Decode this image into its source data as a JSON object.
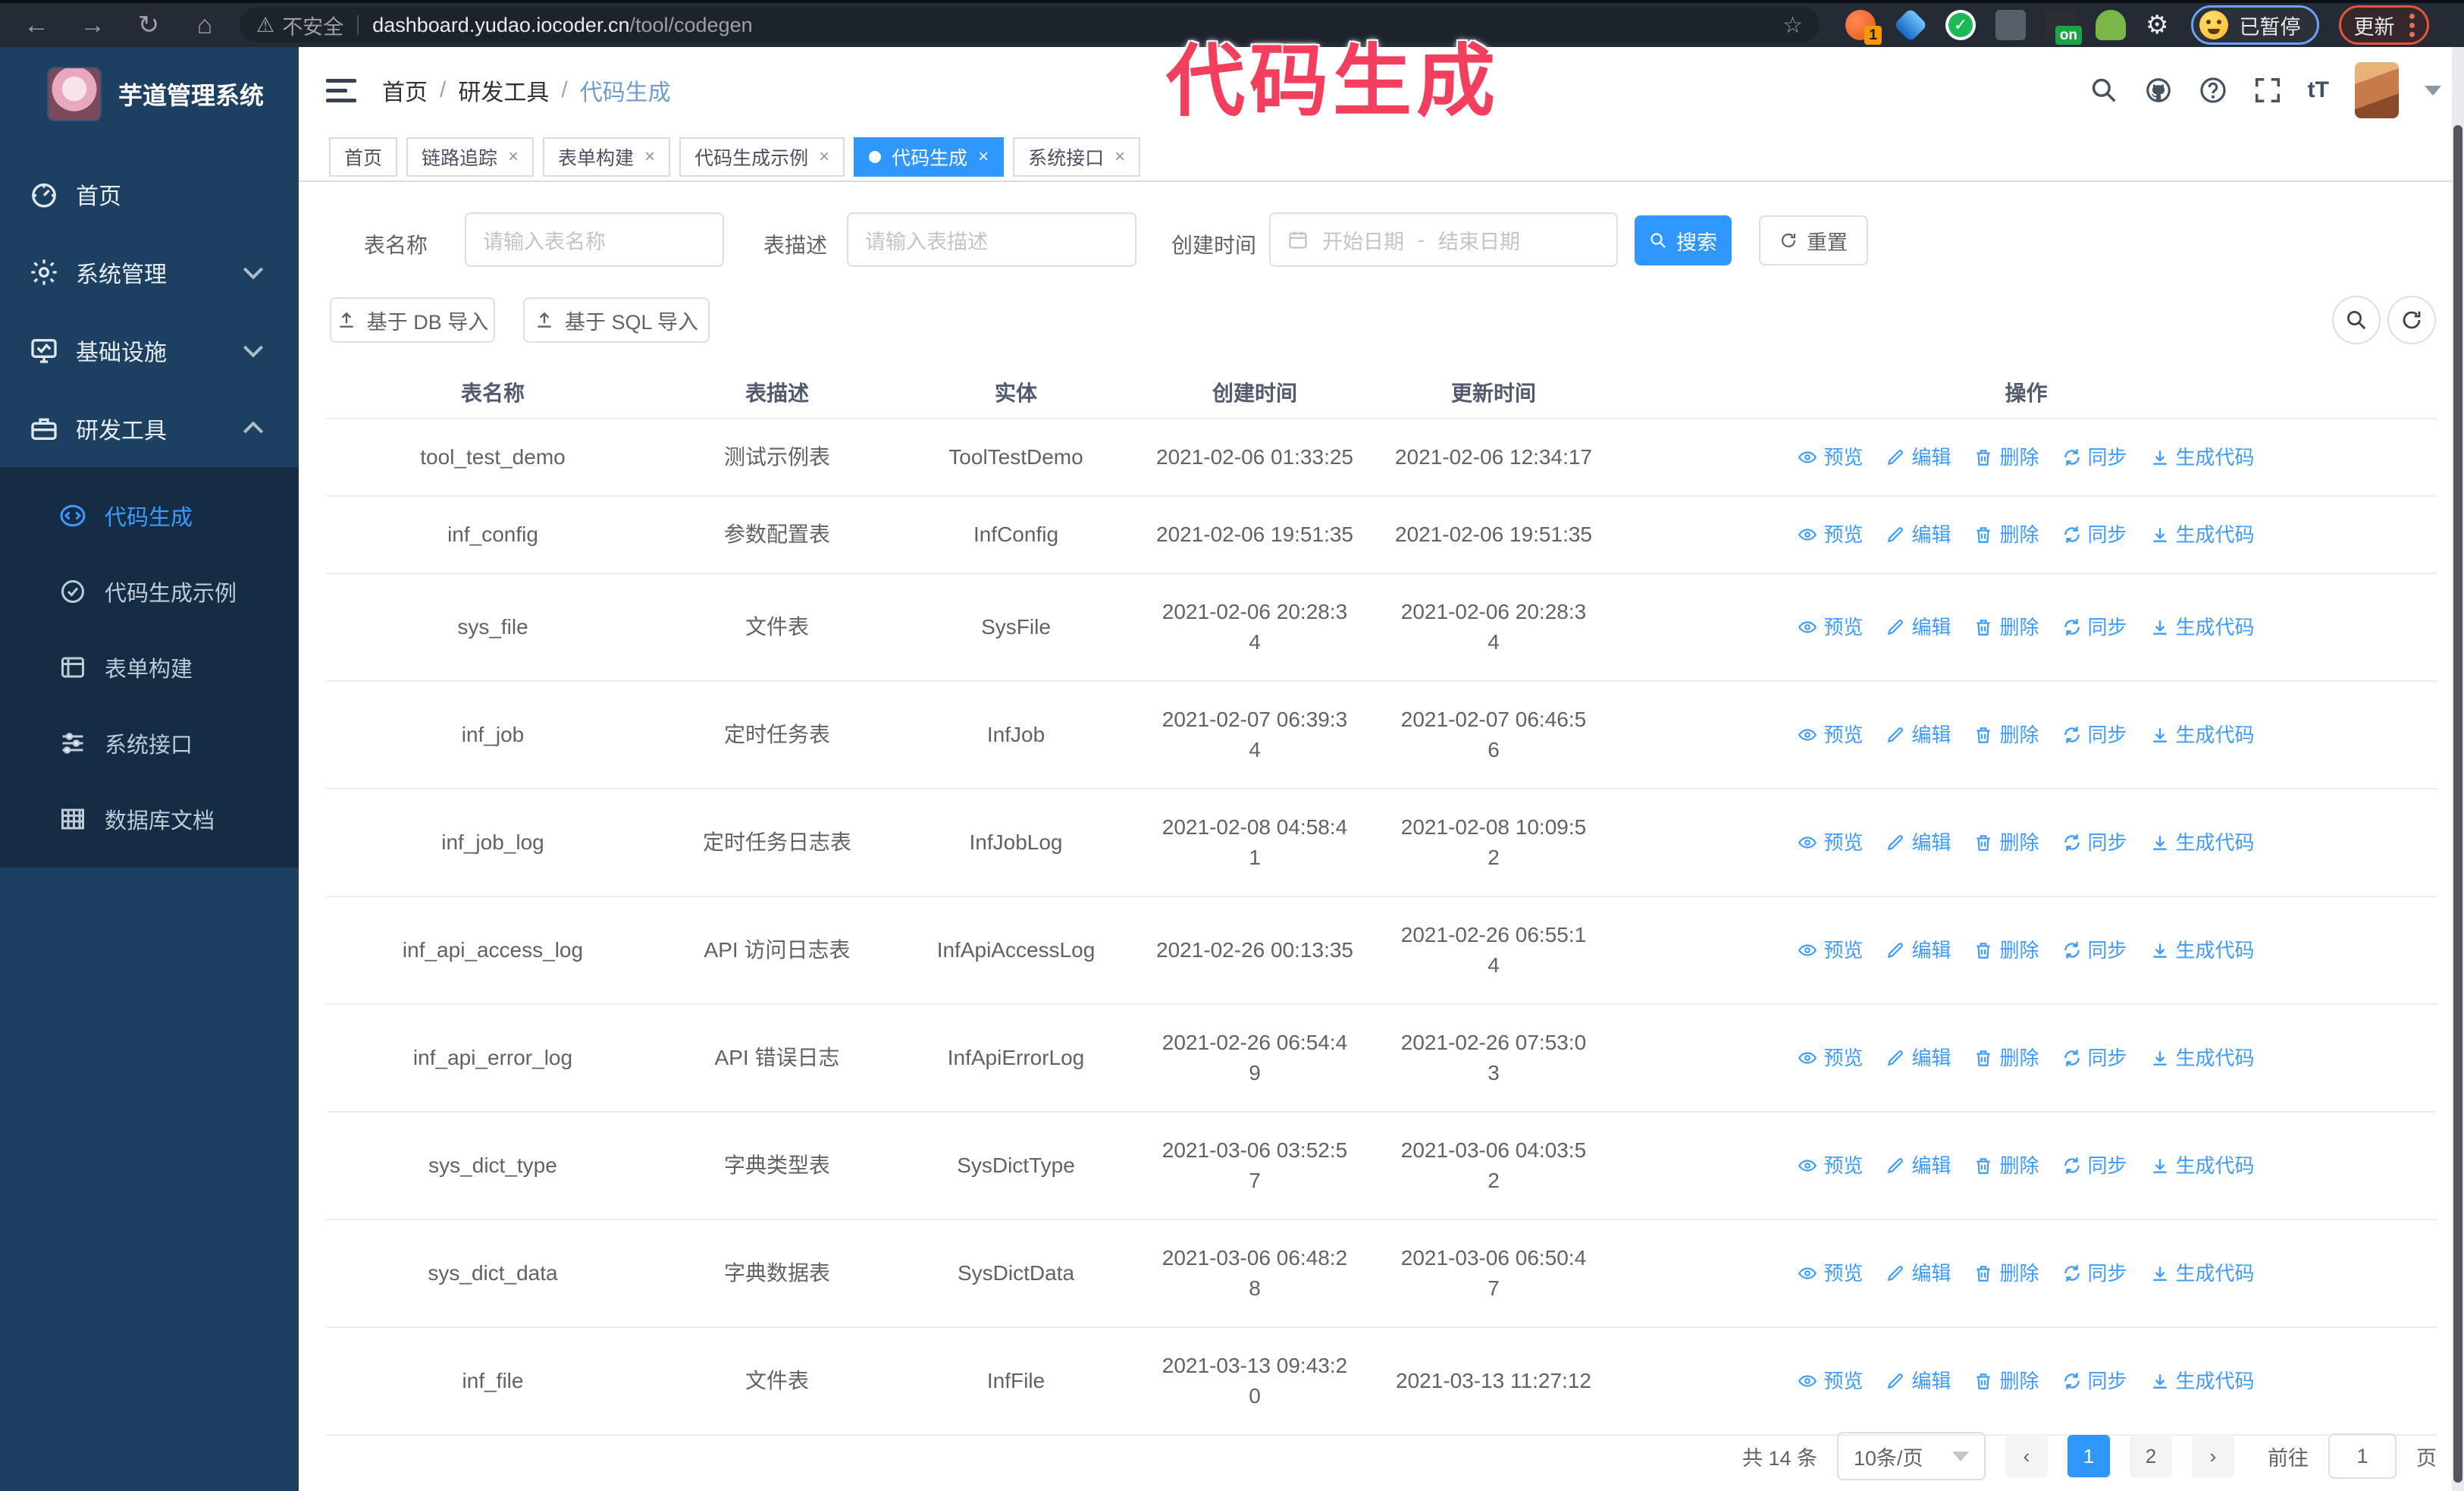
{
  "browser": {
    "nav": {
      "back": "←",
      "forward": "→",
      "reload": "↻",
      "home": "⌂"
    },
    "security_icon": "⚠",
    "security_label": "不安全",
    "url_host": "dashboard.yudao.iocoder.cn",
    "url_path": "/tool/codegen",
    "bookmark_star": "☆",
    "ext_badge_count": "1",
    "ext_badge_on": "on",
    "puzzle_glyph": "⚙",
    "paused_label": "已暂停",
    "update_label": "更新"
  },
  "annotation": {
    "text": "代码生成"
  },
  "sidebar": {
    "logo_title": "芋道管理系统",
    "menu": [
      {
        "label": "首页",
        "icon": "dashboard-icon",
        "chevron": ""
      },
      {
        "label": "系统管理",
        "icon": "gear-icon",
        "chevron": "down"
      },
      {
        "label": "基础设施",
        "icon": "monitor-icon",
        "chevron": "down"
      },
      {
        "label": "研发工具",
        "icon": "toolbox-icon",
        "chevron": "up"
      }
    ],
    "submenu": [
      {
        "label": "代码生成",
        "icon": "code-icon",
        "active": true
      },
      {
        "label": "代码生成示例",
        "icon": "check-clock-icon",
        "active": false
      },
      {
        "label": "表单构建",
        "icon": "form-icon",
        "active": false
      },
      {
        "label": "系统接口",
        "icon": "sliders-icon",
        "active": false
      },
      {
        "label": "数据库文档",
        "icon": "db-table-icon",
        "active": false
      }
    ]
  },
  "header": {
    "breadcrumb": {
      "items": [
        "首页",
        "研发工具",
        "代码生成"
      ],
      "separator": "/"
    },
    "font_size_tool": "tT"
  },
  "tabs": {
    "close_glyph": "×",
    "items": [
      {
        "label": "首页",
        "closable": false,
        "active": false
      },
      {
        "label": "链路追踪",
        "closable": true,
        "active": false
      },
      {
        "label": "表单构建",
        "closable": true,
        "active": false
      },
      {
        "label": "代码生成示例",
        "closable": true,
        "active": false
      },
      {
        "label": "代码生成",
        "closable": true,
        "active": true
      },
      {
        "label": "系统接口",
        "closable": true,
        "active": false
      }
    ]
  },
  "filters": {
    "name_label": "表名称",
    "name_placeholder": "请输入表名称",
    "desc_label": "表描述",
    "desc_placeholder": "请输入表描述",
    "time_label": "创建时间",
    "start_placeholder": "开始日期",
    "range_separator": "-",
    "end_placeholder": "结束日期",
    "search_label": "搜索",
    "reset_label": "重置"
  },
  "toolbar": {
    "db_import_label": "基于 DB 导入",
    "sql_import_label": "基于 SQL 导入"
  },
  "table": {
    "columns": [
      "表名称",
      "表描述",
      "实体",
      "创建时间",
      "更新时间",
      "操作"
    ],
    "actions": [
      {
        "label": "预览",
        "icon": "eye-icon"
      },
      {
        "label": "编辑",
        "icon": "edit-icon"
      },
      {
        "label": "删除",
        "icon": "trash-icon"
      },
      {
        "label": "同步",
        "icon": "sync-icon"
      },
      {
        "label": "生成代码",
        "icon": "download-icon"
      }
    ],
    "rows": [
      {
        "name": "tool_test_demo",
        "desc": "测试示例表",
        "entity": "ToolTestDemo",
        "created": "2021-02-06 01:33:25",
        "updated": "2021-02-06 12:34:17"
      },
      {
        "name": "inf_config",
        "desc": "参数配置表",
        "entity": "InfConfig",
        "created": "2021-02-06 19:51:35",
        "updated": "2021-02-06 19:51:35"
      },
      {
        "name": "sys_file",
        "desc": "文件表",
        "entity": "SysFile",
        "created": "2021-02-06 20:28:3\n4",
        "updated": "2021-02-06 20:28:3\n4"
      },
      {
        "name": "inf_job",
        "desc": "定时任务表",
        "entity": "InfJob",
        "created": "2021-02-07 06:39:3\n4",
        "updated": "2021-02-07 06:46:5\n6"
      },
      {
        "name": "inf_job_log",
        "desc": "定时任务日志表",
        "entity": "InfJobLog",
        "created": "2021-02-08 04:58:4\n1",
        "updated": "2021-02-08 10:09:5\n2"
      },
      {
        "name": "inf_api_access_log",
        "desc": "API 访问日志表",
        "entity": "InfApiAccessLog",
        "created": "2021-02-26 00:13:35",
        "updated": "2021-02-26 06:55:1\n4"
      },
      {
        "name": "inf_api_error_log",
        "desc": "API 错误日志",
        "entity": "InfApiErrorLog",
        "created": "2021-02-26 06:54:4\n9",
        "updated": "2021-02-26 07:53:0\n3"
      },
      {
        "name": "sys_dict_type",
        "desc": "字典类型表",
        "entity": "SysDictType",
        "created": "2021-03-06 03:52:5\n7",
        "updated": "2021-03-06 04:03:5\n2"
      },
      {
        "name": "sys_dict_data",
        "desc": "字典数据表",
        "entity": "SysDictData",
        "created": "2021-03-06 06:48:2\n8",
        "updated": "2021-03-06 06:50:4\n7"
      },
      {
        "name": "inf_file",
        "desc": "文件表",
        "entity": "InfFile",
        "created": "2021-03-13 09:43:2\n0",
        "updated": "2021-03-13 11:27:12"
      }
    ]
  },
  "pagination": {
    "total": "共 14 条",
    "page_size": "10条/页",
    "prev_glyph": "‹",
    "next_glyph": "›",
    "pages": [
      {
        "label": "1",
        "active": true
      },
      {
        "label": "2",
        "active": false
      }
    ],
    "goto_label": "前往",
    "goto_value": "1",
    "page_suffix": "页"
  }
}
